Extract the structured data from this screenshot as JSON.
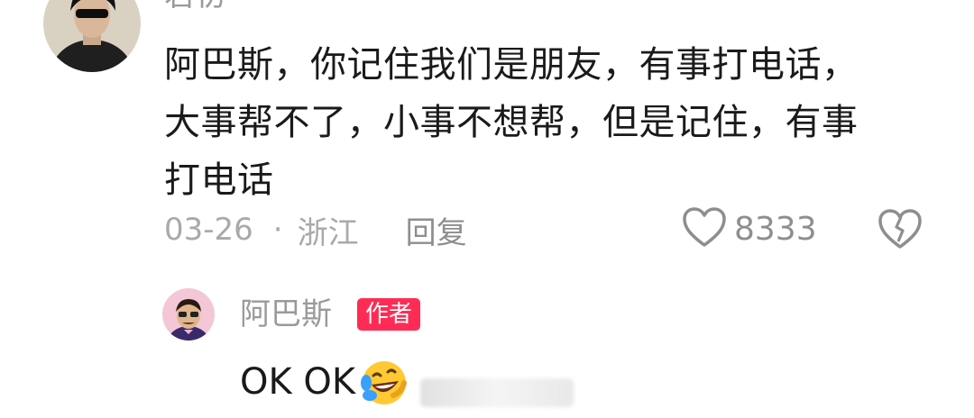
{
  "comment": {
    "username": "君初",
    "text": "阿巴斯，你记住我们是朋友，有事打电话，大事帮不了，小事不想帮，但是记住，有事打电话",
    "date": "03-26",
    "separator": "·",
    "location": "浙江",
    "reply_label": "回复",
    "like_count": "8333",
    "icons": {
      "like": "heart-outline-icon",
      "dislike": "broken-heart-icon"
    }
  },
  "reply": {
    "username": "阿巴斯",
    "badge": "作者",
    "text": "OK OK",
    "emoji": "rolling-laughing-emoji",
    "colors": {
      "badge_bg": "#fe2c55"
    }
  }
}
